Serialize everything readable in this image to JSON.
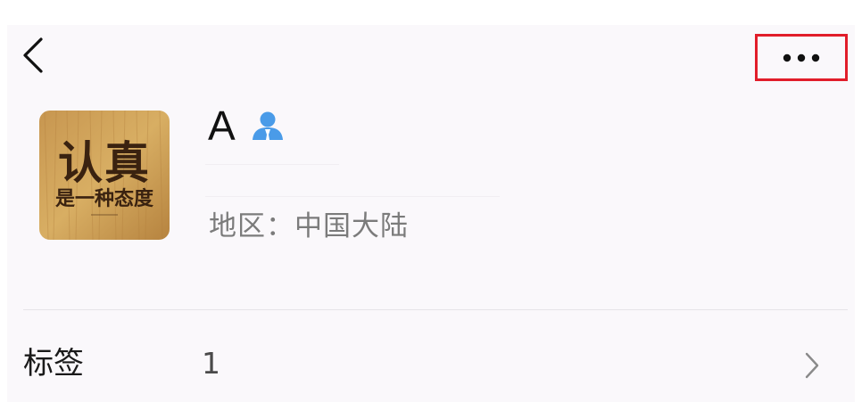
{
  "header": {
    "back_icon": "chevron-left-icon",
    "more_icon": "more-horizontal-icon",
    "highlight_color": "#e11d2a"
  },
  "profile": {
    "avatar_text_line1": "认真",
    "avatar_text_line2": "是一种态度",
    "name": "A",
    "badge_icon": "friend-person-icon",
    "badge_color": "#4a9be8",
    "region": "地区：中国大陆"
  },
  "tag_row": {
    "label": "标签",
    "value": "1",
    "arrow_icon": "chevron-right-icon"
  }
}
